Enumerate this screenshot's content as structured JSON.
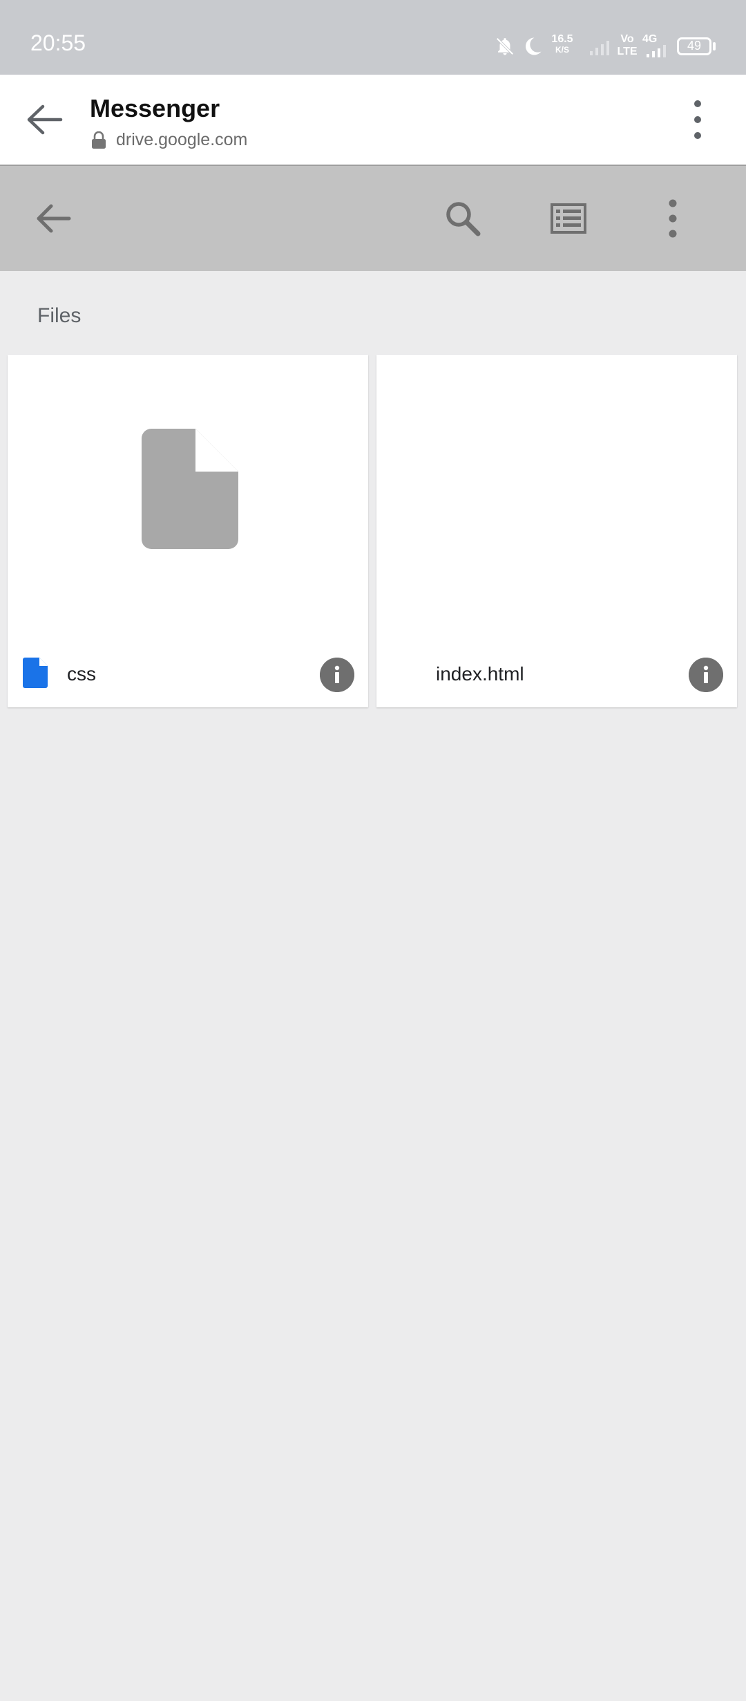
{
  "status_bar": {
    "time": "20:55",
    "speed_value": "16.5",
    "speed_unit": "K/S",
    "volte_top": "Vo",
    "volte_bottom": "LTE",
    "network": "4G",
    "battery": "49",
    "icons": [
      "bell-off-icon",
      "moon-icon",
      "signal-icon",
      "signal-icon",
      "battery-icon"
    ]
  },
  "tab_header": {
    "title": "Messenger",
    "url": "drive.google.com",
    "icons": [
      "back-arrow-icon",
      "lock-icon",
      "more-vert-icon"
    ]
  },
  "toolbar": {
    "icons": [
      "back-arrow-icon",
      "search-icon",
      "list-view-icon",
      "more-vert-icon"
    ],
    "background": "#c2c2c2"
  },
  "section": {
    "label": "Files"
  },
  "files": [
    {
      "name": "css",
      "type_icon": "document-icon",
      "thumbnail": "generic-file-icon"
    },
    {
      "name": "index.html",
      "type_icon": "",
      "thumbnail": ""
    }
  ],
  "colors": {
    "page_bg": "#ececed",
    "status_bar_bg": "#c8cace",
    "doc_blue": "#1a73e8",
    "info_button": "#6f6f6f"
  }
}
